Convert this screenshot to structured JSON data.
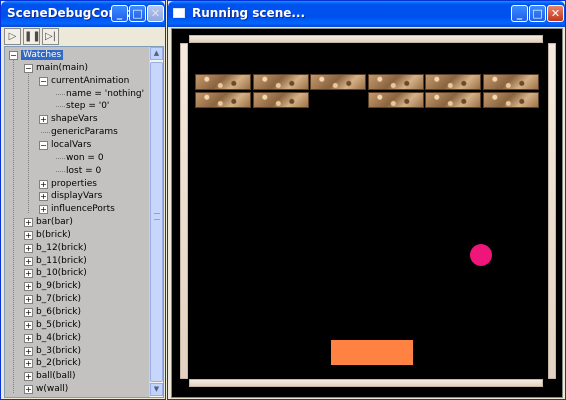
{
  "left_window": {
    "title": "SceneDebugContr...",
    "toolbar": {
      "play_icon": "play-icon",
      "pause_icon": "pause-icon",
      "step_icon": "step-icon"
    },
    "tree": [
      {
        "label": "Watches",
        "depth": 0,
        "expander": "−",
        "selected": true
      },
      {
        "label": "main(main)",
        "depth": 1,
        "expander": "−"
      },
      {
        "label": "currentAnimation",
        "depth": 2,
        "expander": "−"
      },
      {
        "label": "name = 'nothing'",
        "depth": 3,
        "expander": ""
      },
      {
        "label": "step = '0'",
        "depth": 3,
        "expander": ""
      },
      {
        "label": "shapeVars",
        "depth": 2,
        "expander": "+"
      },
      {
        "label": "genericParams",
        "depth": 2,
        "expander": ""
      },
      {
        "label": "localVars",
        "depth": 2,
        "expander": "−"
      },
      {
        "label": "won = 0",
        "depth": 3,
        "expander": ""
      },
      {
        "label": "lost = 0",
        "depth": 3,
        "expander": ""
      },
      {
        "label": "properties",
        "depth": 2,
        "expander": "+"
      },
      {
        "label": "displayVars",
        "depth": 2,
        "expander": "+"
      },
      {
        "label": "influencePorts",
        "depth": 2,
        "expander": "+"
      },
      {
        "label": "bar(bar)",
        "depth": 1,
        "expander": "+"
      },
      {
        "label": "b(brick)",
        "depth": 1,
        "expander": "+"
      },
      {
        "label": "b_12(brick)",
        "depth": 1,
        "expander": "+"
      },
      {
        "label": "b_11(brick)",
        "depth": 1,
        "expander": "+"
      },
      {
        "label": "b_10(brick)",
        "depth": 1,
        "expander": "+"
      },
      {
        "label": "b_9(brick)",
        "depth": 1,
        "expander": "+"
      },
      {
        "label": "b_7(brick)",
        "depth": 1,
        "expander": "+"
      },
      {
        "label": "b_6(brick)",
        "depth": 1,
        "expander": "+"
      },
      {
        "label": "b_5(brick)",
        "depth": 1,
        "expander": "+"
      },
      {
        "label": "b_4(brick)",
        "depth": 1,
        "expander": "+"
      },
      {
        "label": "b_3(brick)",
        "depth": 1,
        "expander": "+"
      },
      {
        "label": "b_2(brick)",
        "depth": 1,
        "expander": "+"
      },
      {
        "label": "ball(ball)",
        "depth": 1,
        "expander": "+"
      },
      {
        "label": "w(wall)",
        "depth": 1,
        "expander": "+"
      }
    ]
  },
  "right_window": {
    "title": "Running scene...",
    "game": {
      "brick_rows": [
        [
          true,
          true,
          true,
          true,
          true,
          true
        ],
        [
          true,
          true,
          false,
          true,
          true,
          true
        ]
      ],
      "ball_color": "#f0157a",
      "paddle_color": "#ff8243",
      "background_color": "#000000"
    }
  },
  "colors": {
    "titlebar": "#0054e3",
    "selection": "#316ac5"
  }
}
